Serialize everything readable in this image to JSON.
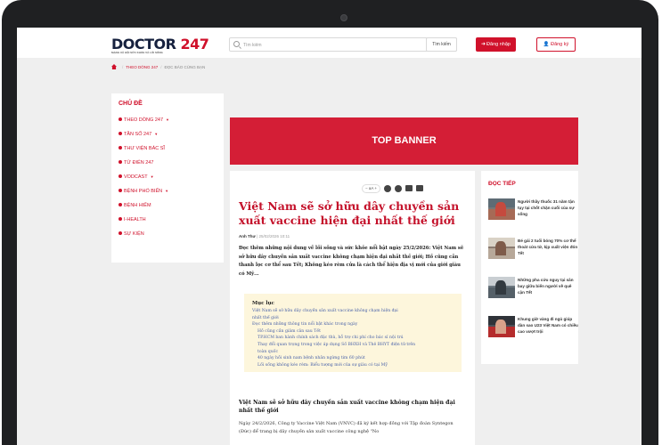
{
  "header": {
    "logo_main": "DOCTOR ",
    "logo_num": "247",
    "tagline": "MẠNG XÃ HỘI SỨC KHỎE VÀ LỐI SỐNG",
    "search_placeholder": "Tìm kiếm",
    "search_button": "Tìm kiếm",
    "login_label": "Đăng nhập",
    "register_label": "Đăng ký"
  },
  "breadcrumb": {
    "item1": "THEO DÒNG 247",
    "item2": "ĐỌC BÁO CÙNG BẠN"
  },
  "sidebar": {
    "title": "CHỦ ĐỀ",
    "items": [
      {
        "label": "THEO DÒNG 247",
        "caret": "▼"
      },
      {
        "label": "TẦN SỐ 247",
        "caret": "▼"
      },
      {
        "label": "THƯ VIỆN BÁC SĨ",
        "caret": ""
      },
      {
        "label": "TỪ ĐIỂN 247",
        "caret": ""
      },
      {
        "label": "VODCAST",
        "caret": "▼"
      },
      {
        "label": "BỆNH PHỔ BIẾN",
        "caret": "▼"
      },
      {
        "label": "BỆNH HIẾM",
        "caret": ""
      },
      {
        "label": "I-HEALTH",
        "caret": ""
      },
      {
        "label": "SỰ KIỆN",
        "caret": ""
      }
    ]
  },
  "banner": {
    "text": "TOP BANNER"
  },
  "article": {
    "font_control": "−  aA  +",
    "title": "Việt Nam sẽ sở hữu dây chuyền sản xuất vaccine hiện đại nhất thế giới",
    "author": "Anh Thư",
    "date": "| 25/02/2026 10:11",
    "sapo": "Đọc thêm những nội dung về lối sống và sức khỏe nổi bật ngày 25/2/2026: Việt Nam sẽ sở hữu dây chuyền sản xuất vaccine không chạm hiện đại nhất thế giới; Hồ cũng cần thanh lọc cơ thể sau Tết; Không kéo rèm cửa là cách thể hiện địa vị mới của giới giàu có Mỹ...",
    "toc_title": "Mục lục",
    "toc": [
      {
        "text": "Việt Nam sẽ sở hữu dây chuyền sản xuất vaccine không chạm hiện đại",
        "level": 1
      },
      {
        "text": "nhất thế giới",
        "level": 1
      },
      {
        "text": "Đọc thêm những thông tin nổi bật khác trong ngày",
        "level": 1
      },
      {
        "text": "Hồ cũng cần giảm cân sau Tết",
        "level": 2
      },
      {
        "text": "TP.HCM ban hành chính sách đặc thù, hỗ trợ chi phí cho bác sĩ nội trú",
        "level": 2
      },
      {
        "text": "Thay đổi quan trọng trong việc áp dụng Số BHXH và Thẻ BHYT điện tử trên",
        "level": 2
      },
      {
        "text": "toàn quốc",
        "level": 2
      },
      {
        "text": "40 ngày hồi sinh nam bệnh nhân ngừng tim 60 phút",
        "level": 2
      },
      {
        "text": "Lối sống không kéo rèm: Biểu tượng mới của sự giàu có tại Mỹ",
        "level": 2
      }
    ],
    "h2": "Việt Nam sẽ sở hữu dây chuyền sản xuất vaccine không chạm hiện đại nhất thế giới",
    "body": "Ngày 24/2/2026, Công ty Vaccine Việt Nam (VNVC) đã ký kết hợp đồng với Tập đoàn Syntegon (Đức) để trang bị dây chuyền sản xuất vaccine công nghệ \"No"
  },
  "related": {
    "title": "ĐỌC TIẾP",
    "items": [
      {
        "text": "Người thầy thuốc 31 năm tận tụy tại chốt chặn cuối của sự sống"
      },
      {
        "text": "Bé gái 2 tuổi bỏng 70% cơ thể thoát cửa tử, kịp xuất viện đón Tết"
      },
      {
        "text": "Những pha cứu nguy tại sân bay giữa biển người về quê cận Tết"
      },
      {
        "text": "Khung giờ vàng đi ngủ giúp dàn sao U23 Việt Nam có chiều cao vượt trội"
      }
    ]
  }
}
